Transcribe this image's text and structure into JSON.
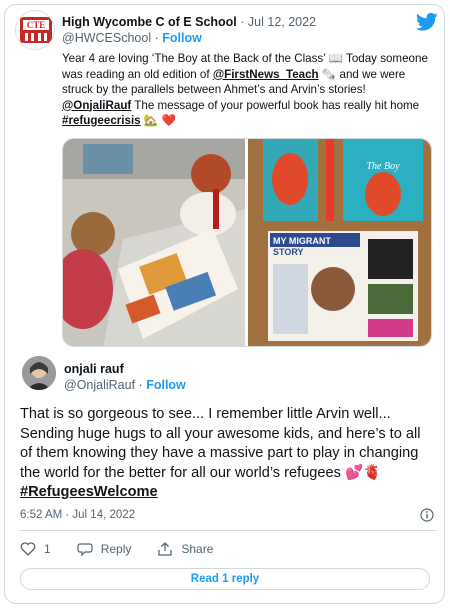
{
  "tweet": {
    "author_name": "High Wycombe C of E School",
    "separator": "·",
    "date": "Jul 12, 2022",
    "handle": "@HWCESchool",
    "follow_label": "Follow",
    "avatar_text": "CTE",
    "text_part1": "Year 4 are loving ‘The Boy at the Back of the Class’ 📖 Today someone was reading an old edition of ",
    "mention1": "@FirstNews_Teach",
    "text_part2": " 🗞️ and we were struck by the parallels between Ahmet’s and Arvin’s stories! ",
    "mention2": "@OnjaliRauf",
    "text_part3": " The message of your powerful book has really hit home ",
    "hashtag": "#refugeecrisis",
    "text_part4": " 🏡 ",
    "heart": "❤️",
    "photo_right_book_title": "The Boy at the Back of the Class",
    "photo_right_magazine_title": "MY MIGRANT STORY"
  },
  "reply": {
    "author_name": "onjali rauf",
    "handle": "@OnjaliRauf",
    "separator": "·",
    "follow_label": "Follow",
    "text_part1": "That is so gorgeous to see... I remember little Arvin well... Sending huge hugs to all your awesome kids, and here’s to all of them knowing they have a massive part to play in changing the world for the better for all our world’s refugees ",
    "emoji": "💕🫀 ",
    "hashtag": "#RefugeesWelcome",
    "timestamp": "6:52 AM · Jul 14, 2022",
    "like_count": "1",
    "reply_label": "Reply",
    "share_label": "Share",
    "read_reply_label": "Read 1 reply"
  },
  "colors": {
    "accent": "#1d9bf0",
    "muted": "#536471",
    "border": "#cfd9de",
    "heart": "#e0245e"
  }
}
